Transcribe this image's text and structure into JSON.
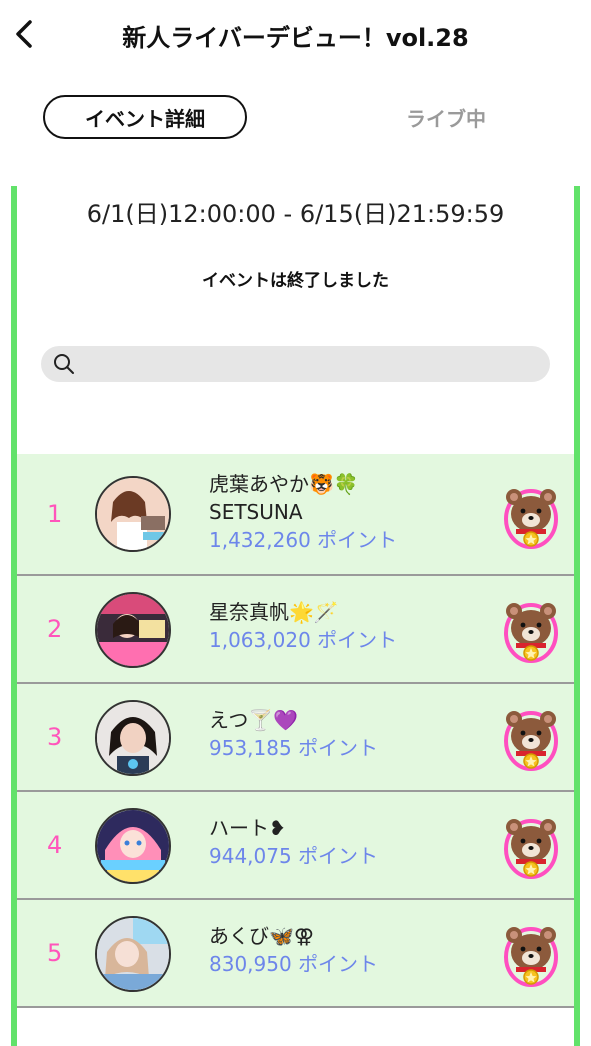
{
  "header": {
    "title": "新人ライバーデビュー！vol.28"
  },
  "tabs": [
    {
      "label": "イベント詳細",
      "active": true
    },
    {
      "label": "ライブ中",
      "active": false
    }
  ],
  "event": {
    "date_range": "6/1(日)12:00:00 - 6/15(日)21:59:59",
    "status": "イベントは終了しました"
  },
  "search": {
    "placeholder": "",
    "value": ""
  },
  "colors": {
    "accent_green": "#62e26a",
    "row_background": "#e3f8df",
    "rank_color": "#ff55bb",
    "points_color": "#6d86ea"
  },
  "ranking": [
    {
      "rank": "1",
      "name": "虎葉あやか🐯🍀",
      "subname": "SETSUNA",
      "points": "1,432,260 ポイント",
      "badge_icon": "bear-medal-icon"
    },
    {
      "rank": "2",
      "name": "星奈真帆🌟🪄",
      "subname": "",
      "points": "1,063,020 ポイント",
      "badge_icon": "bear-medal-icon"
    },
    {
      "rank": "3",
      "name": "えつ🍸💜",
      "subname": "",
      "points": "953,185 ポイント",
      "badge_icon": "bear-medal-icon"
    },
    {
      "rank": "4",
      "name": "ハート❥",
      "subname": "",
      "points": "944,075 ポイント",
      "badge_icon": "bear-medal-icon"
    },
    {
      "rank": "5",
      "name": "あくび🦋⚢",
      "subname": "",
      "points": "830,950 ポイント",
      "badge_icon": "bear-medal-icon"
    }
  ]
}
